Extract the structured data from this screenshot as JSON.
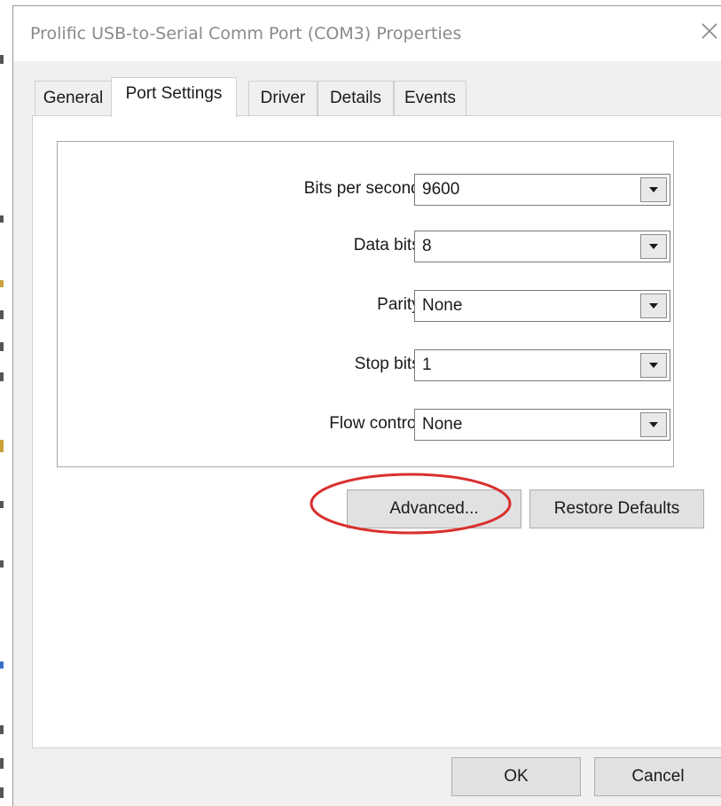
{
  "window": {
    "title": "Prolific USB-to-Serial Comm Port (COM3) Properties"
  },
  "tabs": [
    {
      "label": "General",
      "active": false
    },
    {
      "label": "Port Settings",
      "active": true
    },
    {
      "label": "Driver",
      "active": false
    },
    {
      "label": "Details",
      "active": false
    },
    {
      "label": "Events",
      "active": false
    }
  ],
  "port_settings": {
    "bits_per_second": {
      "label": "Bits per second:",
      "value": "9600"
    },
    "data_bits": {
      "label": "Data bits:",
      "value": "8"
    },
    "parity": {
      "label": "Parity:",
      "value": "None"
    },
    "stop_bits": {
      "label": "Stop bits:",
      "value": "1"
    },
    "flow_control": {
      "label": "Flow control:",
      "value": "None"
    }
  },
  "buttons": {
    "advanced": "Advanced...",
    "restore_defaults": "Restore Defaults",
    "ok": "OK",
    "cancel": "Cancel"
  },
  "colors": {
    "highlight_ellipse": "#d9302e"
  },
  "icons": {
    "close": "close-icon",
    "dropdown": "chevron-down-icon"
  }
}
